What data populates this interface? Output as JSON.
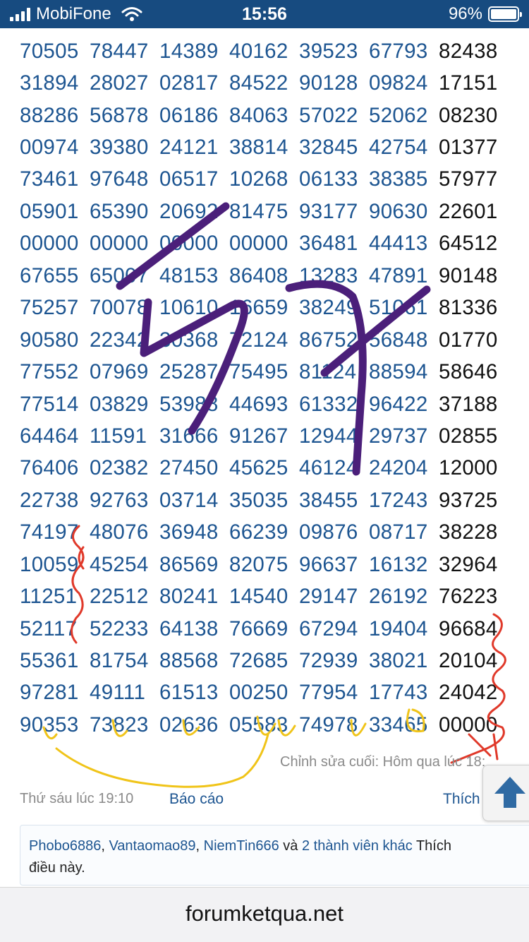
{
  "status_bar": {
    "carrier": "MobiFone",
    "time": "15:56",
    "battery": "96%"
  },
  "number_rows": [
    [
      "70505",
      "78447",
      "14389",
      "40162",
      "39523",
      "67793",
      "82438"
    ],
    [
      "31894",
      "28027",
      "02817",
      "84522",
      "90128",
      "09824",
      "17151"
    ],
    [
      "88286",
      "56878",
      "06186",
      "84063",
      "57022",
      "52062",
      "08230"
    ],
    [
      "00974",
      "39380",
      "24121",
      "38814",
      "32845",
      "42754",
      "01377"
    ],
    [
      "73461",
      "97648",
      "06517",
      "10268",
      "06133",
      "38385",
      "57977"
    ],
    [
      "05901",
      "65390",
      "20692",
      "81475",
      "93177",
      "90630",
      "22601"
    ],
    [
      "00000",
      "00000",
      "00000",
      "00000",
      "36481",
      "44413",
      "64512"
    ],
    [
      "67655",
      "65007",
      "48153",
      "86408",
      "13283",
      "47891",
      "90148"
    ],
    [
      "75257",
      "70078",
      "10610",
      "16659",
      "38249",
      "51061",
      "81336"
    ],
    [
      "90580",
      "22342",
      "30368",
      "72124",
      "86752",
      "56848",
      "01770"
    ],
    [
      "77552",
      "07969",
      "25287",
      "75495",
      "81124",
      "88594",
      "58646"
    ],
    [
      "77514",
      "03829",
      "53988",
      "44693",
      "61332",
      "96422",
      "37188"
    ],
    [
      "64464",
      "11591",
      "31666",
      "91267",
      "12944",
      "29737",
      "02855"
    ],
    [
      "76406",
      "02382",
      "27450",
      "45625",
      "46124",
      "24204",
      "12000"
    ],
    [
      "22738",
      "92763",
      "03714",
      "35035",
      "38455",
      "17243",
      "93725"
    ],
    [
      "74197",
      "48076",
      "36948",
      "66239",
      "09876",
      "08717",
      "38228"
    ],
    [
      "10059",
      "45254",
      "86569",
      "82075",
      "96637",
      "16132",
      "32964"
    ],
    [
      "11251",
      "22512",
      "80241",
      "14540",
      "29147",
      "26192",
      "76223"
    ],
    [
      "52117",
      "52233",
      "64138",
      "76669",
      "67294",
      "19404",
      "96684"
    ],
    [
      "55361",
      "81754",
      "88568",
      "72685",
      "72939",
      "38021",
      "20104"
    ],
    [
      "97281",
      "49111",
      "61513",
      "00250",
      "77954",
      "17743",
      "24042"
    ],
    [
      "90353",
      "73823",
      "02636",
      "05583",
      "74978",
      "33465",
      "00000"
    ]
  ],
  "post": {
    "edit_note": "Chỉnh sửa cuối: Hôm qua lúc 18:",
    "time": "Thứ sáu lúc 19:10",
    "report": "Báo cáo",
    "like": "Thích"
  },
  "likes": {
    "user1": "Phobo6886",
    "user2": "Vantaomao89",
    "user3": "NiemTin666",
    "and": "và",
    "others": "2 thành viên khác",
    "suffix": "Thích",
    "suffix2": "điều này."
  },
  "bottom_bar": {
    "url": "forumketqua.net"
  },
  "colors": {
    "status_bar_bg": "#174b80",
    "number_blue": "#1d5591",
    "scribble_purple": "#4b1f7a",
    "scribble_red": "#e0392a",
    "scribble_yellow": "#f0c419"
  }
}
